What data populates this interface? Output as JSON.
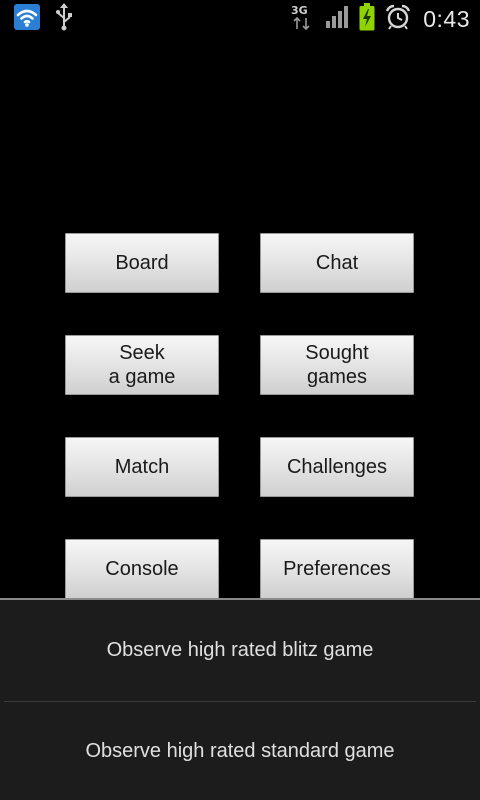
{
  "status_bar": {
    "time": "0:43",
    "network_label": "3G",
    "icons": [
      "wifi-icon",
      "usb-icon",
      "network-3g-icon",
      "signal-icon",
      "battery-charging-icon",
      "alarm-icon"
    ],
    "accent_colors": {
      "wifi_bg": "#2a7fd4",
      "battery": "#8fd400"
    }
  },
  "buttons": {
    "board": "Board",
    "chat": "Chat",
    "seek_game": "Seek\na game",
    "sought_games": "Sought\ngames",
    "match": "Match",
    "challenges": "Challenges",
    "console": "Console",
    "preferences": "Preferences"
  },
  "menu": {
    "items": [
      {
        "label": "Observe high rated blitz game"
      },
      {
        "label": "Observe high rated standard game"
      }
    ]
  }
}
